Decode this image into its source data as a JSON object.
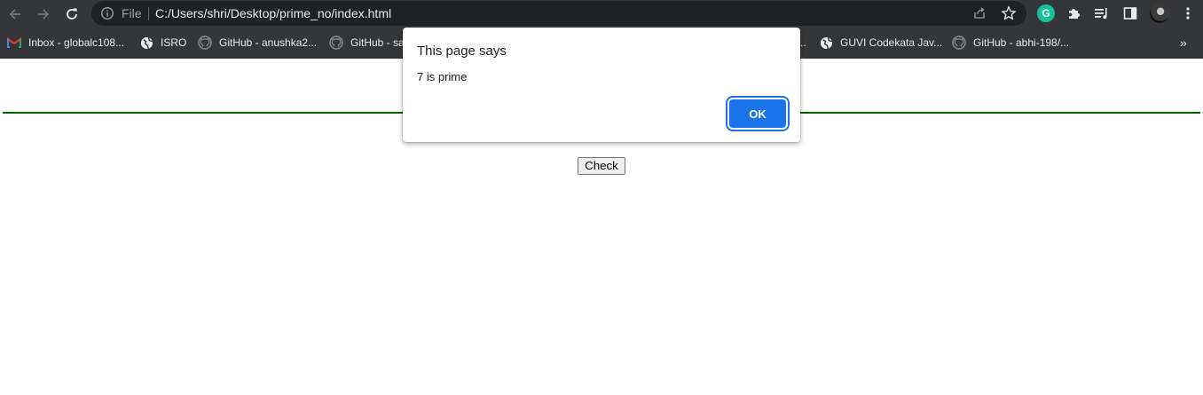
{
  "browser": {
    "address_scheme": "File",
    "url": "C:/Users/shri/Desktop/prime_no/index.html",
    "extension_grammarly_letter": "G"
  },
  "bookmarks": [
    {
      "label": "Inbox - globalc108...",
      "icon": "gmail-icon"
    },
    {
      "label": "ISRO",
      "icon": "globe-icon"
    },
    {
      "label": "GitHub - anushka2...",
      "icon": "github-icon"
    },
    {
      "label": "GitHub - sa",
      "icon": "github-icon"
    },
    {
      "label": "..",
      "icon": ""
    },
    {
      "label": "GUVI Codekata Jav...",
      "icon": "globe-icon"
    },
    {
      "label": "GitHub - abhi-198/...",
      "icon": "github-icon"
    }
  ],
  "bookmarks_overflow": "»",
  "page": {
    "check_label": "Check",
    "rule_color": "#006400"
  },
  "dialog": {
    "title": "This page says",
    "message": "7 is prime",
    "ok_label": "OK",
    "accent_color": "#1a73e8"
  }
}
